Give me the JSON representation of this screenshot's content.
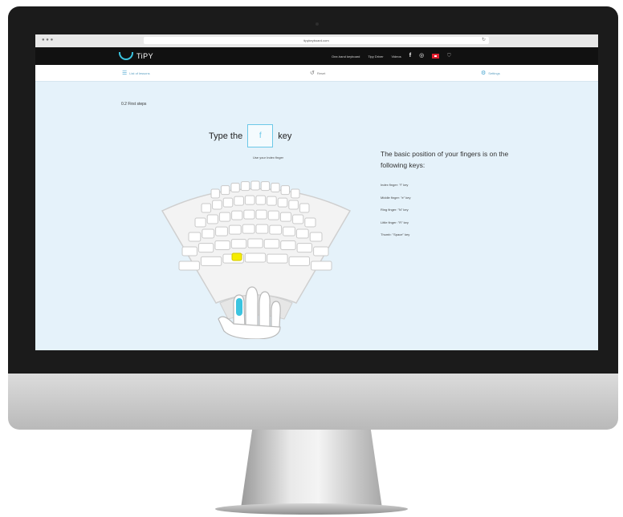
{
  "browser": {
    "url": "tipykeyboard.com"
  },
  "site_nav": {
    "logo_text": "TiPY",
    "links": [
      "One-hand keyboard",
      "Tipy Driver",
      "Videos"
    ],
    "icons": [
      "facebook-icon",
      "instagram-icon",
      "flag-icon",
      "cart-icon"
    ]
  },
  "toolbar": {
    "list_label": "List of lessons",
    "reset_label": "Reset",
    "settings_label": "Settings"
  },
  "lesson": {
    "step_title": "0.2 First steps",
    "prompt_before": "Type the",
    "prompt_key": "f",
    "prompt_after": "key",
    "hint": "Use your Index finger"
  },
  "info": {
    "title": "The basic position of your fingers is on the following keys:",
    "items": [
      "Index finger: \"f\" key",
      "Middle finger: \"e\" key",
      "Ring finger: \"N\" key",
      "Little finger: \"R\" key",
      "Thumb: \"Space\" key"
    ]
  },
  "colors": {
    "accent": "#3bc4e0",
    "highlight_key": "#f5ec00",
    "screen_bg": "#e5f2fa",
    "nav_bg": "#111111"
  }
}
